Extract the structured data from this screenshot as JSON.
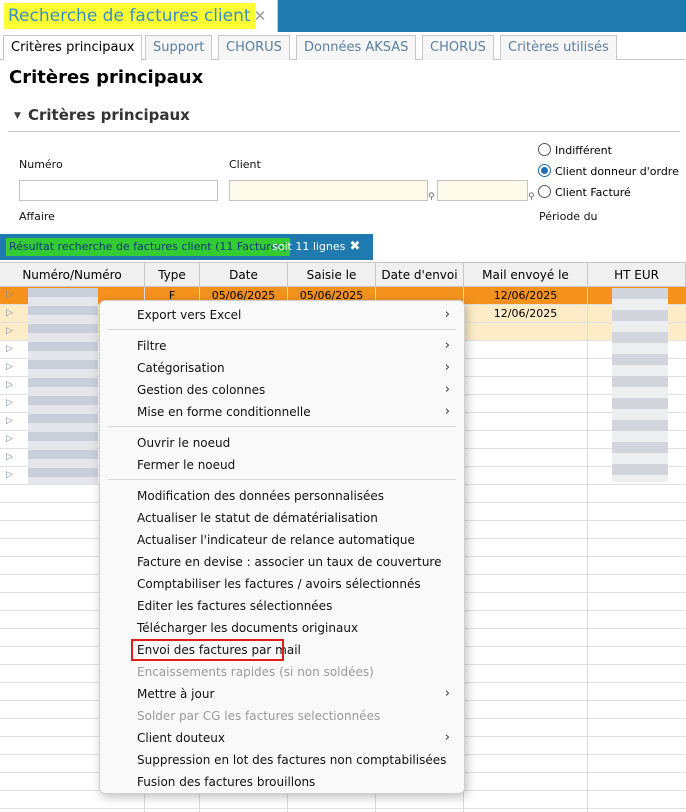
{
  "window": {
    "title": "Recherche de factures client",
    "close_glyph": "✕"
  },
  "tabs": [
    "Critères principaux",
    "Support",
    "CHORUS",
    "Données AKSAS",
    "CHORUS",
    "Critères utilisés"
  ],
  "criteria": {
    "page_title": "Critères principaux",
    "section_title": "Critères principaux",
    "label_numero": "Numéro",
    "label_client": "Client",
    "label_affaire": "Affaire",
    "label_periode": "Période du",
    "radio_indifferent": "Indifférent",
    "radio_donneur": "Client donneur d'ordre",
    "radio_facture": "Client Facturé",
    "radio_selected": "Client donneur d'ordre"
  },
  "results": {
    "title": "Résultat recherche de factures client (11 Factures)",
    "count": "soit 11 lignes",
    "close_glyph": "✖"
  },
  "grid": {
    "headers": [
      "Numéro/Numéro",
      "Type",
      "Date",
      "Saisie le",
      "Date d'envoi",
      "Mail envoyé le",
      "HT EUR"
    ],
    "rows": [
      {
        "type": "F",
        "date": "05/06/2025",
        "saisie": "05/06/2025",
        "envoi": "",
        "mail": "12/06/2025"
      },
      {
        "type": "",
        "date": "",
        "saisie": "",
        "envoi": "",
        "mail": "12/06/2025"
      }
    ]
  },
  "context_menu": {
    "export_excel": "Export vers Excel",
    "filtre": "Filtre",
    "categorisation": "Catégorisation",
    "gestion_colonnes": "Gestion des colonnes",
    "mise_en_forme": "Mise en forme conditionnelle",
    "ouvrir_noeud": "Ouvrir le noeud",
    "fermer_noeud": "Fermer le noeud",
    "modif_donnees": "Modification des données personnalisées",
    "actualiser_statut": "Actualiser le statut de dématérialisation",
    "actualiser_relance": "Actualiser l'indicateur de relance automatique",
    "facture_devise": "Facture en devise : associer un taux de couverture",
    "comptabiliser": "Comptabiliser les factures / avoirs sélectionnés",
    "editer": "Editer les factures sélectionnées",
    "telecharger": "Télécharger les documents originaux",
    "envoi_mail": "Envoi des factures par mail",
    "encaissements": "Encaissements rapides (si non soldées)",
    "mettre_a_jour": "Mettre à jour",
    "solder_cg": "Solder par CG les factures selectionnées",
    "client_douteux": "Client douteux",
    "suppression_lot": "Suppression en lot des factures non comptabilisées",
    "fusion": "Fusion des factures brouillons",
    "submenu_arrow": "›"
  },
  "colors": {
    "accent_blue": "#1f7ab0",
    "title_highlight": "#ffff33",
    "result_highlight": "#33cc33",
    "selected_row": "#f5921e",
    "alt_row": "#fdecc8",
    "menu_highlight_border": "#e01e1e"
  }
}
